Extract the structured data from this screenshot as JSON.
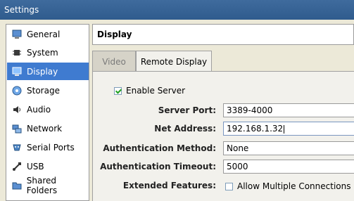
{
  "window": {
    "title": "Settings"
  },
  "sidebar": {
    "items": [
      {
        "label": "General",
        "icon": "monitor-icon",
        "active": false
      },
      {
        "label": "System",
        "icon": "chip-icon",
        "active": false
      },
      {
        "label": "Display",
        "icon": "display-icon",
        "active": true
      },
      {
        "label": "Storage",
        "icon": "disk-icon",
        "active": false
      },
      {
        "label": "Audio",
        "icon": "speaker-icon",
        "active": false
      },
      {
        "label": "Network",
        "icon": "network-icon",
        "active": false
      },
      {
        "label": "Serial Ports",
        "icon": "serial-port-icon",
        "active": false
      },
      {
        "label": "USB",
        "icon": "usb-icon",
        "active": false
      },
      {
        "label": "Shared Folders",
        "icon": "folder-icon",
        "active": false
      }
    ]
  },
  "main": {
    "title": "Display",
    "tabs": [
      {
        "label": "Video",
        "active": false
      },
      {
        "label": "Remote Display",
        "active": true
      }
    ],
    "remote_display": {
      "enable_server": {
        "label": "Enable Server",
        "checked": true
      },
      "server_port": {
        "label": "Server Port:",
        "value": "3389-4000"
      },
      "net_address": {
        "label": "Net Address:",
        "value": "192.168.1.32"
      },
      "auth_method": {
        "label": "Authentication Method:",
        "value": "None"
      },
      "auth_timeout": {
        "label": "Authentication Timeout:",
        "value": "5000"
      },
      "extended_features": {
        "label": "Extended Features:",
        "allow_multiple": {
          "label": "Allow Multiple Connections",
          "checked": false
        }
      }
    }
  },
  "colors": {
    "titlebar": "#2f5b8d",
    "selection": "#3f7bd0",
    "window_bg": "#ece9d8",
    "panel_bg": "#f2f1ec"
  }
}
